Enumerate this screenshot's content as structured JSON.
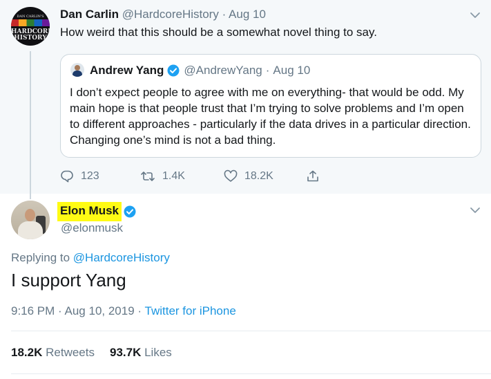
{
  "parent_tweet": {
    "author_name": "Dan Carlin",
    "author_handle": "@HardcoreHistory",
    "separator": "·",
    "date": "Aug 10",
    "text": "How weird that this should be a somewhat novel thing to say.",
    "avatar_text": [
      "DAN CARLIN'S",
      "HARDCORE",
      "HISTORY"
    ],
    "quoted_tweet": {
      "author_name": "Andrew Yang",
      "author_handle": "@AndrewYang",
      "date": "Aug 10",
      "text": "I don’t expect people to agree with me on everything- that would be odd. My main hope is that people trust that I’m trying to solve problems and I’m open to different approaches - particularly if the data drives in a particular direction. Changing one’s mind is not a bad thing."
    },
    "actions": {
      "reply_icon": "reply-icon",
      "reply_count": "123",
      "retweet_icon": "retweet-icon",
      "retweet_count": "1.4K",
      "like_icon": "heart-icon",
      "like_count": "18.2K",
      "share_icon": "share-icon"
    }
  },
  "main_tweet": {
    "author_name": "Elon Musk",
    "author_handle": "@elonmusk",
    "replying_prefix": "Replying to",
    "replying_to": "@HardcoreHistory",
    "text": "I support Yang",
    "time": "9:16 PM",
    "date": "Aug 10, 2019",
    "separator": "·",
    "source": "Twitter for iPhone",
    "retweets_count": "18.2K",
    "retweets_label": "Retweets",
    "likes_count": "93.7K",
    "likes_label": "Likes"
  },
  "colors": {
    "link": "#1b95e0",
    "muted": "#657786",
    "highlight": "#fffb14",
    "verified": "#1da1f2",
    "parent_bg": "#f5f8fa"
  }
}
